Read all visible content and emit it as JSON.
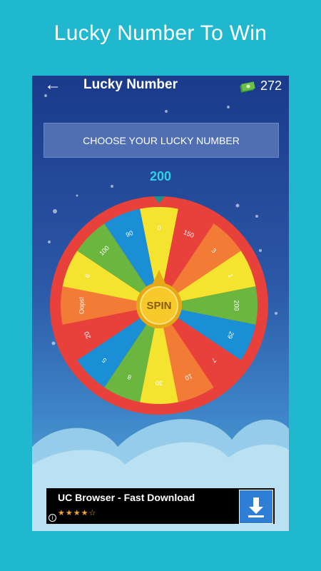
{
  "promo": {
    "title": "Lucky Number To Win"
  },
  "appbar": {
    "back_icon": "back-arrow-icon",
    "title": "Lucky Number",
    "coins": "272",
    "coin_icon": "money-stack-icon"
  },
  "choose_button": {
    "label": "CHOOSE YOUR LUCKY NUMBER"
  },
  "lucky_value": "200",
  "wheel": {
    "center_label": "SPIN",
    "segments": [
      {
        "label": "0",
        "color": "#f4e430"
      },
      {
        "label": "150",
        "color": "#e8403a"
      },
      {
        "label": "3",
        "color": "#f27b36"
      },
      {
        "label": "1",
        "color": "#f4e430"
      },
      {
        "label": "200",
        "color": "#6ab63f"
      },
      {
        "label": "29",
        "color": "#1a8fd6"
      },
      {
        "label": "7",
        "color": "#e8403a"
      },
      {
        "label": "10",
        "color": "#f27b36"
      },
      {
        "label": "30",
        "color": "#f4e430"
      },
      {
        "label": "8",
        "color": "#6ab63f"
      },
      {
        "label": "5",
        "color": "#1a8fd6"
      },
      {
        "label": "20",
        "color": "#e8403a"
      },
      {
        "label": "Oops!",
        "color": "#f27b36"
      },
      {
        "label": "6",
        "color": "#f4e430"
      },
      {
        "label": "100",
        "color": "#6ab63f"
      },
      {
        "label": "90",
        "color": "#1a8fd6"
      }
    ],
    "rim_color": "#e8403a",
    "pointer_color": "#1f8e8e"
  },
  "ad": {
    "title": "UC Browser - Fast Download",
    "stars": "★★★★☆",
    "info_icon": "info-icon",
    "download_icon": "download-icon"
  }
}
